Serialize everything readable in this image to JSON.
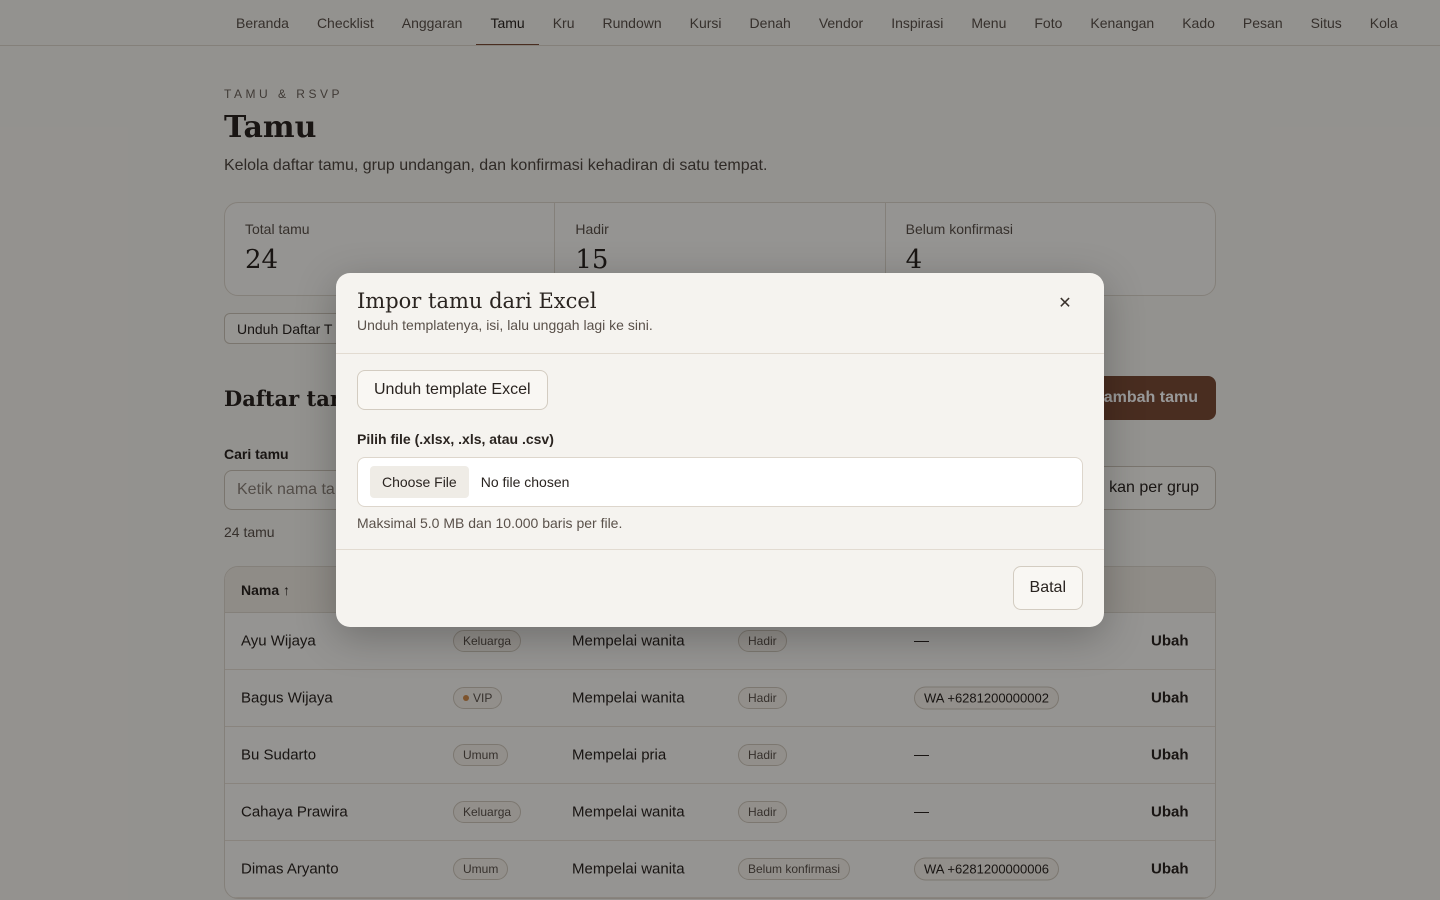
{
  "nav": {
    "tabs": [
      "Beranda",
      "Checklist",
      "Anggaran",
      "Tamu",
      "Kru",
      "Rundown",
      "Kursi",
      "Denah",
      "Vendor",
      "Inspirasi",
      "Menu",
      "Foto",
      "Kenangan",
      "Kado",
      "Pesan",
      "Situs",
      "Kola"
    ],
    "active": "Tamu"
  },
  "page": {
    "eyebrow": "TAMU & RSVP",
    "title": "Tamu",
    "subtitle": "Kelola daftar tamu, grup undangan, dan konfirmasi kehadiran di satu tempat."
  },
  "stats": [
    {
      "label": "Total tamu",
      "value": "24"
    },
    {
      "label": "Hadir",
      "value": "15"
    },
    {
      "label": "Belum konfirmasi",
      "value": "4"
    }
  ],
  "download_list_label": "Unduh Daftar T",
  "list": {
    "title": "Daftar tamu",
    "add_label": "ambah tamu",
    "search_label": "Cari tamu",
    "search_placeholder": "Ketik nama ta",
    "group_label": "kan per grup",
    "count_text": "24 tamu"
  },
  "table": {
    "header_name": "Nama ↑",
    "rows": [
      {
        "name": "Ayu Wijaya",
        "group": "Keluarga",
        "vip": false,
        "side": "Mempelai wanita",
        "status": "Hadir",
        "contact": "—",
        "edit": "Ubah"
      },
      {
        "name": "Bagus Wijaya",
        "group": "VIP",
        "vip": true,
        "side": "Mempelai wanita",
        "status": "Hadir",
        "contact": "WA +6281200000002",
        "edit": "Ubah"
      },
      {
        "name": "Bu Sudarto",
        "group": "Umum",
        "vip": false,
        "side": "Mempelai pria",
        "status": "Hadir",
        "contact": "—",
        "edit": "Ubah"
      },
      {
        "name": "Cahaya Prawira",
        "group": "Keluarga",
        "vip": false,
        "side": "Mempelai wanita",
        "status": "Hadir",
        "contact": "—",
        "edit": "Ubah"
      },
      {
        "name": "Dimas Aryanto",
        "group": "Umum",
        "vip": false,
        "side": "Mempelai wanita",
        "status": "Belum konfirmasi",
        "contact": "WA +6281200000006",
        "edit": "Ubah"
      }
    ]
  },
  "modal": {
    "title": "Impor tamu dari Excel",
    "subtitle": "Unduh templatenya, isi, lalu unggah lagi ke sini.",
    "close_icon": "close-icon",
    "template_button": "Unduh template Excel",
    "file_label": "Pilih file (.xlsx, .xls, atau .csv)",
    "choose_file": "Choose File",
    "no_file": "No file chosen",
    "hint": "Maksimal 5.0 MB dan 10.000 baris per file.",
    "cancel": "Batal"
  },
  "colors": {
    "accent": "#7a4b36",
    "background": "#f6f4ef",
    "overlay": "rgba(0,0,0,0.4)"
  }
}
